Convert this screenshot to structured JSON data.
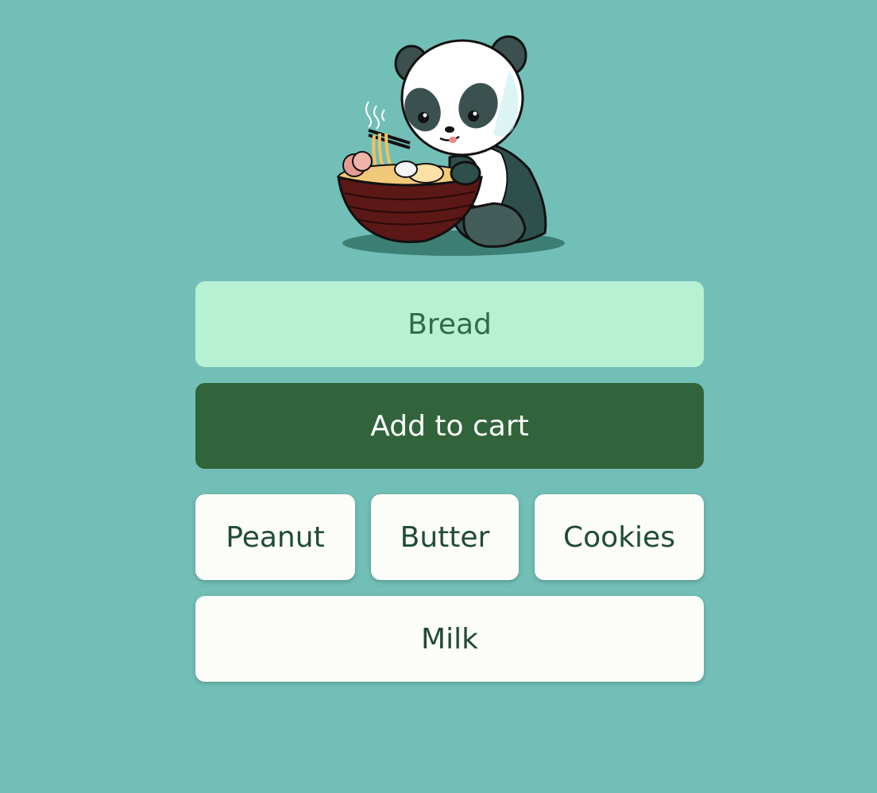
{
  "app": {
    "logo_icon": "panda-eating-ramen-logo",
    "background_color": "#72bfb7"
  },
  "form": {
    "input_value": "Bread",
    "placeholder": "",
    "add_button_label": "Add to cart",
    "input_bg_color": "#b7f1d3",
    "button_bg_color": "#31643a"
  },
  "cart": {
    "items": [
      {
        "label": "Peanut"
      },
      {
        "label": "Butter"
      },
      {
        "label": "Cookies"
      },
      {
        "label": "Milk"
      }
    ],
    "item_bg_color": "#fcfcf8",
    "item_text_color": "#1f4b37"
  }
}
